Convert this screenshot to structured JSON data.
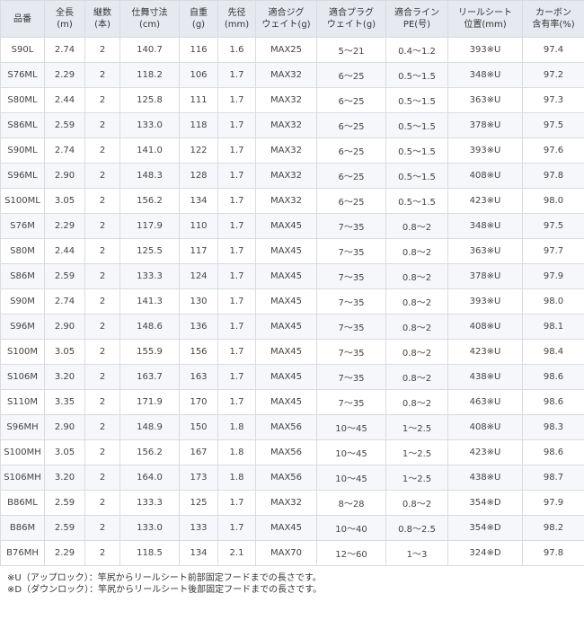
{
  "table": {
    "headers": [
      [
        "品番"
      ],
      [
        "全長",
        "(m)"
      ],
      [
        "継数",
        "(本)"
      ],
      [
        "仕舞寸法",
        "(cm)"
      ],
      [
        "自重",
        "(g)"
      ],
      [
        "先径",
        "(mm)"
      ],
      [
        "適合ジグ",
        "ウェイト(g)"
      ],
      [
        "適合プラグ",
        "ウェイト(g)"
      ],
      [
        "適合ライン",
        "PE(号)"
      ],
      [
        "リールシート",
        "位置(mm)"
      ],
      [
        "カーボン",
        "含有率(%)"
      ]
    ],
    "rows": [
      [
        "S90L",
        "2.74",
        "2",
        "140.7",
        "116",
        "1.6",
        "MAX25",
        "5～21",
        "0.4～1.2",
        "393※U",
        "97.4"
      ],
      [
        "S76ML",
        "2.29",
        "2",
        "118.2",
        "106",
        "1.7",
        "MAX32",
        "6～25",
        "0.5～1.5",
        "348※U",
        "97.2"
      ],
      [
        "S80ML",
        "2.44",
        "2",
        "125.8",
        "111",
        "1.7",
        "MAX32",
        "6～25",
        "0.5～1.5",
        "363※U",
        "97.3"
      ],
      [
        "S86ML",
        "2.59",
        "2",
        "133.0",
        "118",
        "1.7",
        "MAX32",
        "6～25",
        "0.5～1.5",
        "378※U",
        "97.5"
      ],
      [
        "S90ML",
        "2.74",
        "2",
        "141.0",
        "122",
        "1.7",
        "MAX32",
        "6～25",
        "0.5～1.5",
        "393※U",
        "97.6"
      ],
      [
        "S96ML",
        "2.90",
        "2",
        "148.3",
        "128",
        "1.7",
        "MAX32",
        "6～25",
        "0.5～1.5",
        "408※U",
        "97.8"
      ],
      [
        "S100ML",
        "3.05",
        "2",
        "156.2",
        "134",
        "1.7",
        "MAX32",
        "6～25",
        "0.5～1.5",
        "423※U",
        "98.0"
      ],
      [
        "S76M",
        "2.29",
        "2",
        "117.9",
        "110",
        "1.7",
        "MAX45",
        "7～35",
        "0.8～2",
        "348※U",
        "97.5"
      ],
      [
        "S80M",
        "2.44",
        "2",
        "125.5",
        "117",
        "1.7",
        "MAX45",
        "7～35",
        "0.8～2",
        "363※U",
        "97.7"
      ],
      [
        "S86M",
        "2.59",
        "2",
        "133.3",
        "124",
        "1.7",
        "MAX45",
        "7～35",
        "0.8～2",
        "378※U",
        "97.9"
      ],
      [
        "S90M",
        "2.74",
        "2",
        "141.3",
        "130",
        "1.7",
        "MAX45",
        "7～35",
        "0.8～2",
        "393※U",
        "98.0"
      ],
      [
        "S96M",
        "2.90",
        "2",
        "148.6",
        "136",
        "1.7",
        "MAX45",
        "7～35",
        "0.8～2",
        "408※U",
        "98.1"
      ],
      [
        "S100M",
        "3.05",
        "2",
        "155.9",
        "156",
        "1.7",
        "MAX45",
        "7～35",
        "0.8～2",
        "423※U",
        "98.4"
      ],
      [
        "S106M",
        "3.20",
        "2",
        "163.7",
        "163",
        "1.7",
        "MAX45",
        "7～35",
        "0.8～2",
        "438※U",
        "98.6"
      ],
      [
        "S110M",
        "3.35",
        "2",
        "171.9",
        "170",
        "1.7",
        "MAX45",
        "7～35",
        "0.8～2",
        "463※U",
        "98.6"
      ],
      [
        "S96MH",
        "2.90",
        "2",
        "148.9",
        "150",
        "1.8",
        "MAX56",
        "10～45",
        "1～2.5",
        "408※U",
        "98.3"
      ],
      [
        "S100MH",
        "3.05",
        "2",
        "156.2",
        "167",
        "1.8",
        "MAX56",
        "10～45",
        "1～2.5",
        "423※U",
        "98.6"
      ],
      [
        "S106MH",
        "3.20",
        "2",
        "164.0",
        "173",
        "1.8",
        "MAX56",
        "10～45",
        "1～2.5",
        "438※U",
        "98.7"
      ],
      [
        "B86ML",
        "2.59",
        "2",
        "133.3",
        "125",
        "1.7",
        "MAX32",
        "8～28",
        "0.8～2",
        "354※D",
        "97.9"
      ],
      [
        "B86M",
        "2.59",
        "2",
        "133.0",
        "133",
        "1.7",
        "MAX45",
        "10～40",
        "0.8～2.5",
        "354※D",
        "98.2"
      ],
      [
        "B76MH",
        "2.29",
        "2",
        "118.5",
        "134",
        "2.1",
        "MAX70",
        "12～60",
        "1～3",
        "324※D",
        "97.8"
      ]
    ]
  },
  "notes": [
    "※U（アップロック）：竿尻からリールシート前部固定フードまでの長さです。",
    "※D（ダウンロック）：竿尻からリールシート後部固定フードまでの長さです。"
  ]
}
